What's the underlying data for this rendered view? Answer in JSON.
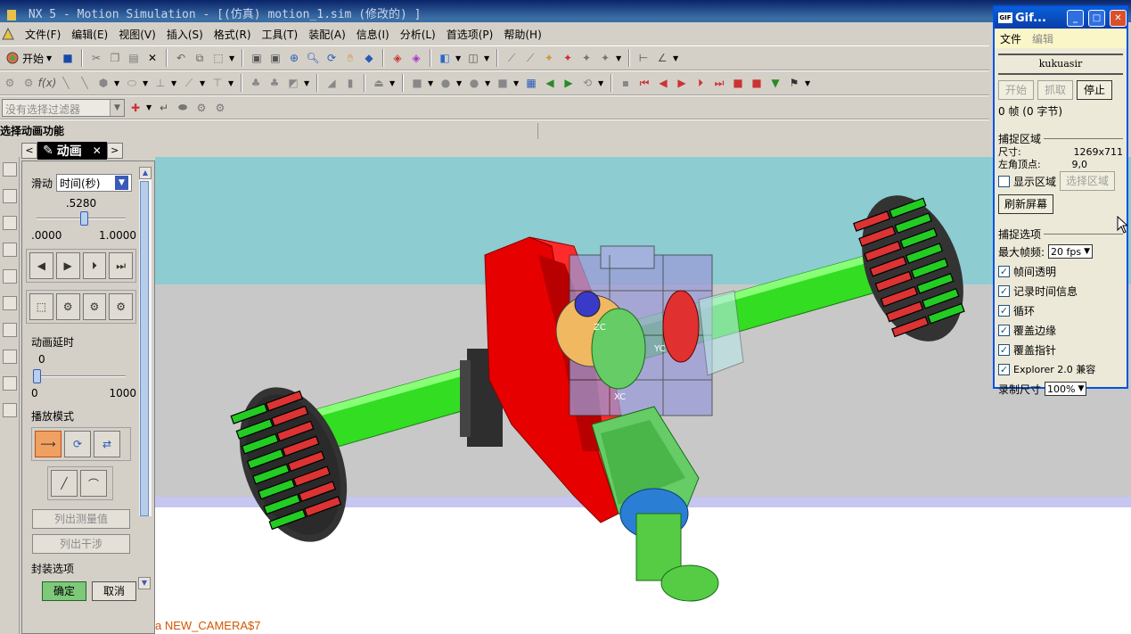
{
  "window": {
    "title": "NX 5 - Motion Simulation - [(仿真) motion_1.sim (修改的) ]"
  },
  "menubar": {
    "items": [
      "文件(F)",
      "编辑(E)",
      "视图(V)",
      "插入(S)",
      "格式(R)",
      "工具(T)",
      "装配(A)",
      "信息(I)",
      "分析(L)",
      "首选项(P)",
      "帮助(H)"
    ]
  },
  "toolbar": {
    "start_label": "开始",
    "start_icon": "start-icon"
  },
  "selection": {
    "filter_placeholder": "没有选择过滤器"
  },
  "cue": {
    "text": "选择动画功能"
  },
  "panel": {
    "title": "动画",
    "slider_label": "滑动",
    "slider_mode": "时间(秒)",
    "slider_value": ".5280",
    "slider_value_fraction": 0.528,
    "slider_min": ".0000",
    "slider_max": "1.0000",
    "delay_label": "动画延时",
    "delay_value": "0",
    "delay_value_fraction": 0.0,
    "delay_min": "0",
    "delay_max": "1000",
    "playmode_label": "播放模式",
    "list_measure_label": "列出测量值",
    "list_interference_label": "列出干涉",
    "package_options_label": "封装选项",
    "ok_label": "确定",
    "cancel_label": "取消"
  },
  "graphics": {
    "camera_text": "a NEW_CAMERA$7",
    "axis_labels": [
      "ZC",
      "YC",
      "XC"
    ],
    "colors": {
      "gear": "#e60000",
      "axle": "#33dd22",
      "tire_tread_green": "#22cc22",
      "tire_tread_red": "#dd3333",
      "housing": "#9b9bd8",
      "pinion": "#66cc66",
      "bearing": "#2a7fd4",
      "background_top": "#8dccd1",
      "background_mid": "#c8c8c8"
    }
  },
  "gif": {
    "title": "Gif...",
    "menu_file": "文件",
    "menu_edit": "编辑",
    "author": "kukuasir",
    "btn_start": "开始",
    "btn_capture": "抓取",
    "btn_stop": "停止",
    "frames": "0 帧 (0 字节)",
    "capture_area_label": "捕捉区域",
    "size_label": "尺寸:",
    "size_value": "1269x711",
    "corner_label": "左角顶点:",
    "corner_value": "9,0",
    "show_area_label": "显示区域",
    "select_area_label": "选择区域",
    "refresh_label": "刷新屏幕",
    "capture_options_label": "捕捉选项",
    "max_fps_label": "最大帧频:",
    "max_fps_value": "20 fps",
    "opt_frame_transparent": "帧间透明",
    "opt_record_time": "记录时间信息",
    "opt_loop": "循环",
    "opt_cover_edge": "覆盖边缘",
    "opt_cover_pointer": "覆盖指针",
    "opt_explorer": "Explorer 2.0 兼容",
    "record_size_label": "录制尺寸",
    "record_size_value": "100%"
  }
}
